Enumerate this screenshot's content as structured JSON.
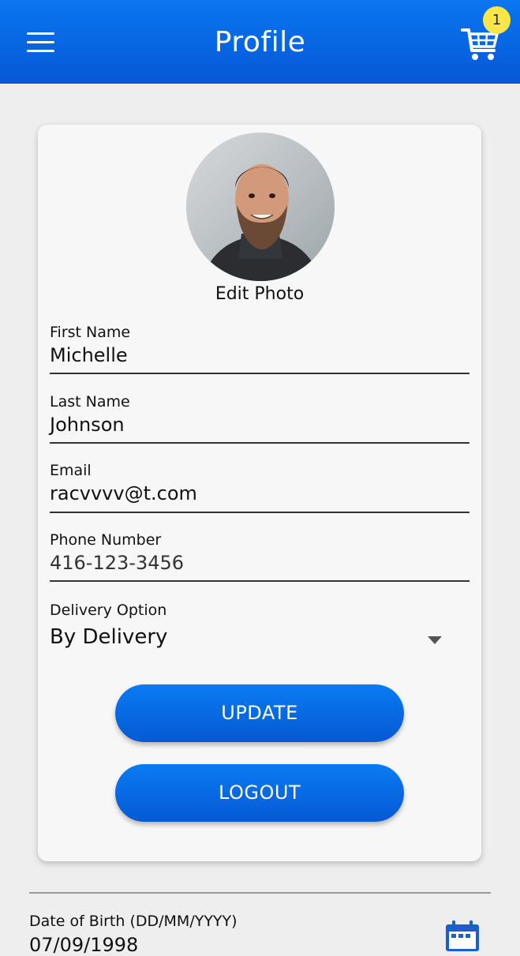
{
  "appbar": {
    "title": "Profile",
    "menu_icon": "hamburger-menu-icon",
    "cart_icon": "shopping-cart-icon",
    "cart_count": "1",
    "colors": {
      "bar": "#0a6ae8",
      "badge": "#fbe64a"
    }
  },
  "profile": {
    "edit_photo_label": "Edit Photo",
    "fields": {
      "first_name": {
        "label": "First Name",
        "value": "Michelle"
      },
      "last_name": {
        "label": "Last Name",
        "value": "Johnson"
      },
      "email": {
        "label": "Email",
        "value": "racvvvv@t.com"
      },
      "phone": {
        "label": "Phone Number",
        "value": "416-123-3456"
      },
      "delivery": {
        "label": "Delivery Option",
        "value": "By Delivery"
      }
    },
    "update_label": "UPDATE",
    "logout_label": "LOGOUT"
  },
  "dob": {
    "label": "Date of Birth (DD/MM/YYYY)",
    "value": "07/09/1998",
    "calendar_icon": "calendar-icon"
  }
}
